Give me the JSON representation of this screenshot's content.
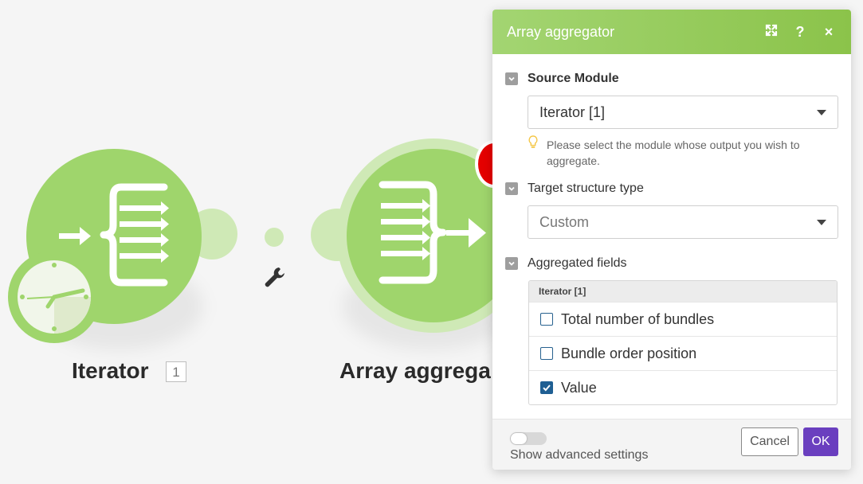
{
  "canvas": {
    "modules": [
      {
        "name": "Iterator",
        "badge": "1"
      },
      {
        "name": "Array aggrega"
      }
    ]
  },
  "panel": {
    "title": "Array aggregator",
    "icons": [
      "expand-icon",
      "help-icon",
      "close-icon"
    ],
    "help_glyph": "?",
    "close_glyph": "×",
    "source_module": {
      "label": "Source Module",
      "value": "Iterator [1]",
      "hint": "Please select the module whose output you wish to aggregate."
    },
    "target_structure": {
      "label": "Target structure type",
      "value": "Custom"
    },
    "aggregated_fields": {
      "label": "Aggregated fields",
      "group": "Iterator [1]",
      "items": [
        {
          "label": "Total number of bundles",
          "checked": false
        },
        {
          "label": "Bundle order position",
          "checked": false
        },
        {
          "label": "Value",
          "checked": true
        }
      ]
    },
    "footer": {
      "advanced_label": "Show advanced settings",
      "cancel": "Cancel",
      "ok": "OK"
    }
  },
  "colors": {
    "module_green": "#9fd56c",
    "header_green": "#8bc34a",
    "ok_purple": "#6a3fbf",
    "checkbox_blue": "#1f5f93",
    "error_red": "#e50000"
  }
}
